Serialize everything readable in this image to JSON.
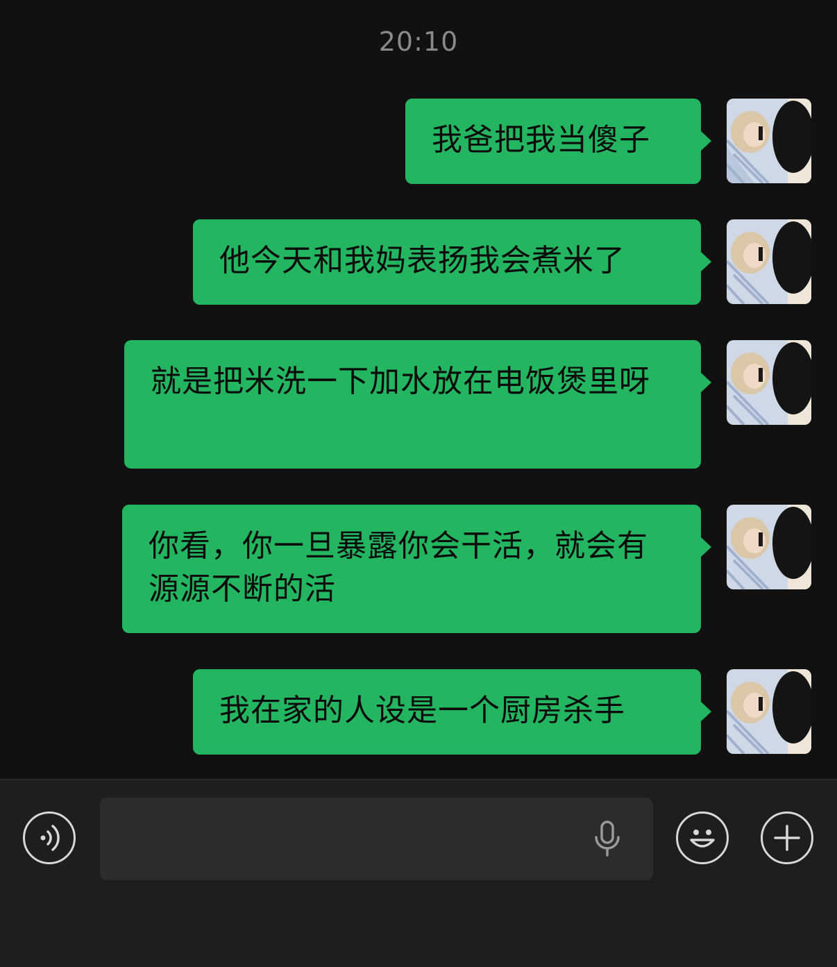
{
  "timestamp": "20:10",
  "messages": [
    {
      "text": "我爸把我当傻子"
    },
    {
      "text": "他今天和我妈表扬我会煮米了"
    },
    {
      "text": "就是把米洗一下加水放在电饭煲里呀"
    },
    {
      "text": "你看，你一旦暴露你会干活，就会有源源不断的活"
    },
    {
      "text": "我在家的人设是一个厨房杀手"
    }
  ],
  "input": {
    "value": ""
  },
  "icons": {
    "voice": "voice-mode-icon",
    "mic": "microphone-icon",
    "emoji": "emoji-icon",
    "plus": "plus-icon"
  },
  "colors": {
    "bubble": "#23b560",
    "background": "#111111",
    "input_bar": "#1e1e1e"
  }
}
